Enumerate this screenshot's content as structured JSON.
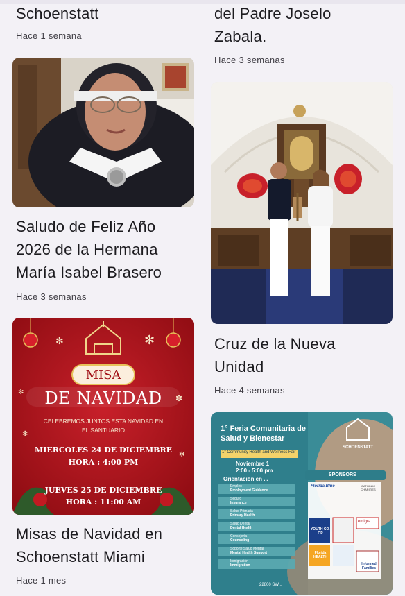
{
  "feed": {
    "left": [
      {
        "title_line": "Schoenstatt",
        "meta": "Hace 1 semana"
      },
      {
        "title_lines": [
          "Saludo de Feliz Año",
          "2026 de la Hermana",
          "María Isabel Brasero"
        ],
        "meta": "Hace 3 semanas"
      },
      {
        "title_lines": [
          "Misas de Navidad en",
          "Schoenstatt Miami"
        ],
        "meta": "Hace 1 mes"
      }
    ],
    "right": [
      {
        "title_lines": [
          "del Padre Joselo",
          "Zabala."
        ],
        "meta": "Hace 3 semanas"
      },
      {
        "title_lines": [
          "Cruz de la Nueva",
          "Unidad"
        ],
        "meta": "Hace 4 semanas"
      }
    ]
  },
  "poster_navidad": {
    "misa": "MISA",
    "de_navidad": "DE NAVIDAD",
    "celebremos": "CELEBREMOS JUNTOS ESTA NAVIDAD EN",
    "santuario": "EL SANTUARIO",
    "date1": "MIERCOLES 24 DE DICIEMBRE",
    "hora1": "HORA : 4:00 PM",
    "date2": "JUEVES 25 DE DICIEMBRE",
    "hora2": "HORA : 11:00 AM"
  },
  "poster_feria": {
    "title1": "1° Feria Comunitaria de",
    "title2": "Salud y Bienestar",
    "subtitle": "1° Community Health and Wellness Fair",
    "date": "Noviembre 1",
    "time": "2:00 - 5:00 pm",
    "orientacion": "Orientación en ...",
    "brand": "SCHOENSTATT",
    "sponsors": "SPONSORS",
    "services": [
      {
        "es": "Empleo",
        "en": "Employment Guidance"
      },
      {
        "es": "Seguro",
        "en": "Insurance"
      },
      {
        "es": "Salud Primaria",
        "en": "Primary Health"
      },
      {
        "es": "Salud Dental",
        "en": "Dental Health"
      },
      {
        "es": "Consejería",
        "en": "Counseling"
      },
      {
        "es": "Soporte Salud Mental",
        "en": "Mental Health Support"
      },
      {
        "es": "Inmigración",
        "en": "Immigration"
      }
    ],
    "sponsor_names": [
      "Florida Blue",
      "CATHOLIC CHARITIES",
      "YOUTH CO-OP",
      "emigra",
      "Florida HEALTH",
      "Informed Families"
    ],
    "address": "22800 SW..."
  },
  "colors": {
    "background": "#f3f1f6",
    "poster_red": "#b3121a",
    "gold": "#e7c25a"
  }
}
